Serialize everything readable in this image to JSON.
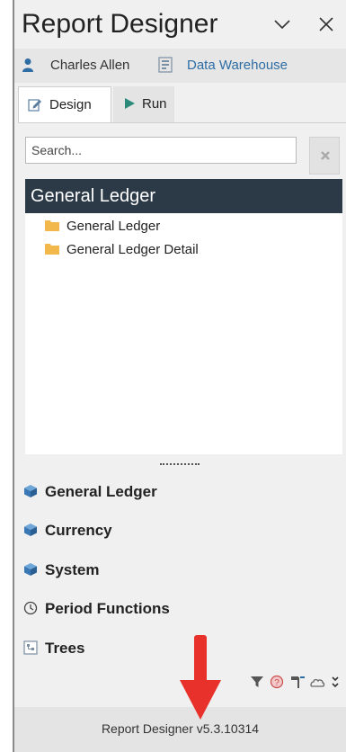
{
  "window": {
    "title": "Report Designer"
  },
  "user_bar": {
    "user_name": "Charles Allen",
    "database": "Data Warehouse"
  },
  "tabs": [
    {
      "label": "Design",
      "active": true
    },
    {
      "label": "Run",
      "active": false
    }
  ],
  "search": {
    "placeholder": "Search...",
    "value": ""
  },
  "tree": {
    "header": "General Ledger",
    "items": [
      {
        "label": "General Ledger",
        "icon": "folder-icon"
      },
      {
        "label": "General Ledger Detail",
        "icon": "folder-icon"
      }
    ]
  },
  "nav": {
    "items": [
      {
        "label": "General Ledger",
        "icon": "cube-icon"
      },
      {
        "label": "Currency",
        "icon": "cube-icon"
      },
      {
        "label": "System",
        "icon": "cube-icon"
      },
      {
        "label": "Period Functions",
        "icon": "clock-icon"
      },
      {
        "label": "Trees",
        "icon": "tree-icon"
      }
    ]
  },
  "toolbar": {
    "icons": [
      "filter-icon",
      "help-icon",
      "hammer-icon",
      "cloud-icon",
      "expand-icon"
    ]
  },
  "status": {
    "version": "Report Designer v5.3.10314"
  },
  "colors": {
    "header_bg": "#2b3a46",
    "link_blue": "#2e6da4",
    "arrow_red": "#e8312b",
    "folder": "#f2b84b",
    "cube": "#3a78b5"
  }
}
